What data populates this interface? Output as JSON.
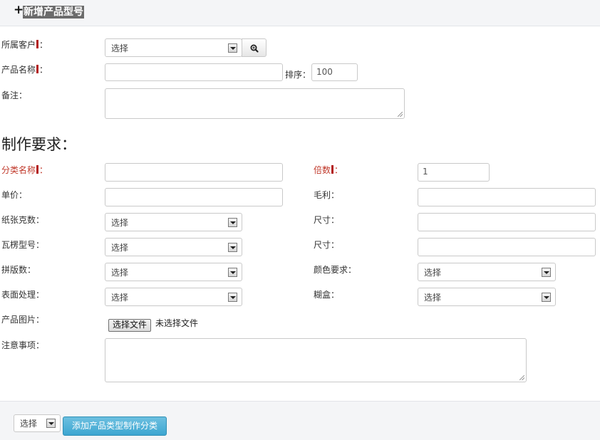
{
  "header": {
    "plus": "+",
    "title": "新增产品型号"
  },
  "form": {
    "customer": {
      "label": "所属客户",
      "colon": "：",
      "select_value": "选择"
    },
    "product_name": {
      "label": "产品名称",
      "colon": "：",
      "value": ""
    },
    "sort": {
      "label": "排序：",
      "value": "100"
    },
    "remark": {
      "label": "备注：",
      "value": ""
    }
  },
  "requirements": {
    "title": "制作要求：",
    "category_name": {
      "label": "分类名称",
      "colon": "：",
      "value": ""
    },
    "multiple": {
      "label": "倍数",
      "colon": "：",
      "value": "1"
    },
    "unit_price": {
      "label": "单价：",
      "value": ""
    },
    "gross_profit": {
      "label": "毛利：",
      "value": ""
    },
    "paper_weight": {
      "label": "纸张克数：",
      "select_value": "选择"
    },
    "size1": {
      "label": "尺寸：",
      "value": ""
    },
    "flute_type": {
      "label": "瓦楞型号：",
      "select_value": "选择"
    },
    "size2": {
      "label": "尺寸：",
      "value": ""
    },
    "imposition": {
      "label": "拼版数：",
      "select_value": "选择"
    },
    "color_req": {
      "label": "颜色要求：",
      "select_value": "选择"
    },
    "surface": {
      "label": "表面处理：",
      "select_value": "选择"
    },
    "box": {
      "label": "糊盒：",
      "select_value": "选择"
    },
    "product_image": {
      "label": "产品图片：",
      "button": "选择文件",
      "status": "未选择文件"
    },
    "notes": {
      "label": "注意事项：",
      "value": ""
    }
  },
  "footer": {
    "select_value": "选择",
    "add_button": "添加产品类型制作分类"
  },
  "colors": {
    "required_marker": "#b31b1b",
    "red_label": "#c0392b",
    "primary": "#3da6d1",
    "header_bg": "#f4f5f7"
  },
  "icons": {
    "search": "magnifier-zoom-icon",
    "dropdown": "chevron-down-icon"
  }
}
